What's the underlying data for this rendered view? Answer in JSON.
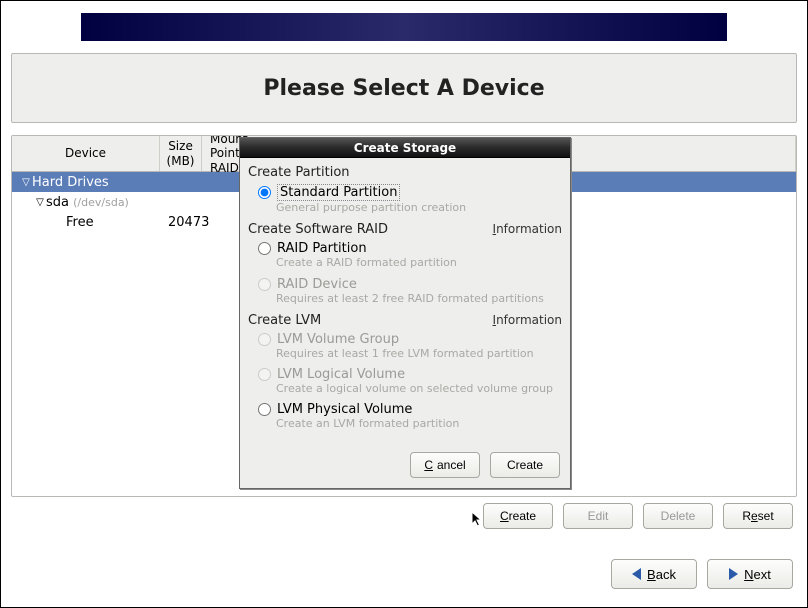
{
  "header": {
    "title": "Please Select A Device"
  },
  "table": {
    "columns": {
      "device": "Device",
      "size": "Size (MB)",
      "mount": "Mount Point/ RAID"
    },
    "rows": [
      {
        "label": "Hard Drives",
        "selected": true,
        "indent": 0,
        "expander": "▽"
      },
      {
        "label": "sda",
        "devpath": "(/dev/sda)",
        "indent": 1,
        "expander": "▽"
      },
      {
        "label": "Free",
        "size": "20473",
        "indent": 2
      }
    ]
  },
  "buttons": {
    "create": "Create",
    "edit": "Edit",
    "delete": "Delete",
    "reset": "Reset",
    "back": "Back",
    "next": "Next"
  },
  "dialog": {
    "title": "Create Storage",
    "sections": {
      "partition": {
        "title": "Create Partition",
        "options": [
          {
            "label": "Standard Partition",
            "desc": "General purpose partition creation",
            "checked": true,
            "enabled": true
          }
        ]
      },
      "raid": {
        "title": "Create Software RAID",
        "info": "Information",
        "options": [
          {
            "label": "RAID Partition",
            "desc": "Create a RAID formated partition",
            "checked": false,
            "enabled": true
          },
          {
            "label": "RAID Device",
            "desc": "Requires at least 2 free RAID formated partitions",
            "checked": false,
            "enabled": false
          }
        ]
      },
      "lvm": {
        "title": "Create LVM",
        "info": "Information",
        "options": [
          {
            "label": "LVM Volume Group",
            "desc": "Requires at least 1 free LVM formated partition",
            "checked": false,
            "enabled": false
          },
          {
            "label": "LVM Logical Volume",
            "desc": "Create a logical volume on selected volume group",
            "checked": false,
            "enabled": false
          },
          {
            "label": "LVM Physical Volume",
            "desc": "Create an LVM formated partition",
            "checked": false,
            "enabled": true
          }
        ]
      }
    },
    "buttons": {
      "cancel": "Cancel",
      "create": "Create"
    }
  }
}
